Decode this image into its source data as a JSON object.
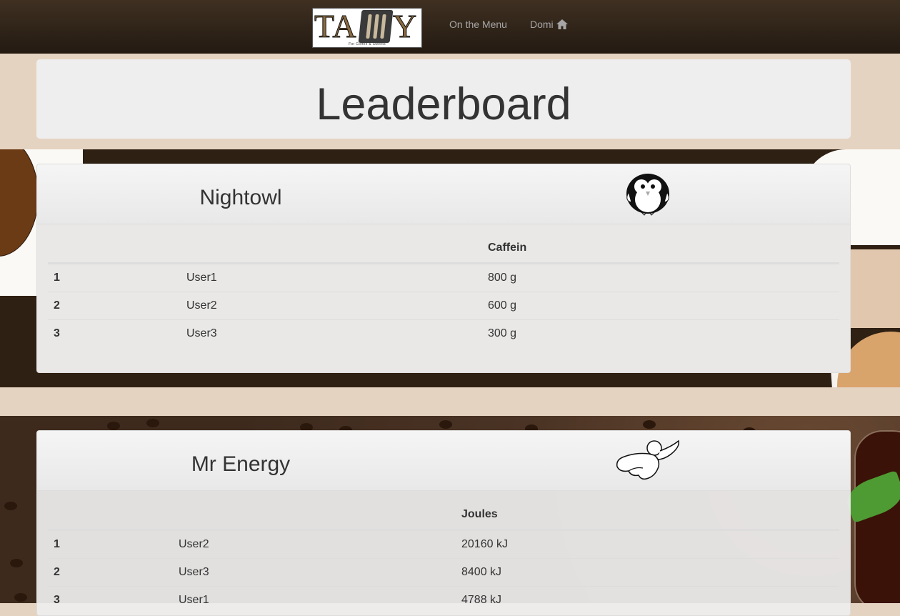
{
  "navbar": {
    "logo_letters_left": "TA",
    "logo_letters_right": "Y",
    "logo_caption": "For Coffee & Sweets",
    "menu_link": "On the Menu",
    "user_link": "Domi",
    "user_icon": "home-icon"
  },
  "page": {
    "title": "Leaderboard"
  },
  "boards": [
    {
      "title": "Nightowl",
      "icon": "owl-icon",
      "metric_header": "Caffein",
      "rows": [
        {
          "rank": "1",
          "user": "User1",
          "value": "800 g"
        },
        {
          "rank": "2",
          "user": "User2",
          "value": "600 g"
        },
        {
          "rank": "3",
          "user": "User3",
          "value": "300 g"
        }
      ]
    },
    {
      "title": "Mr Energy",
      "icon": "superhero-icon",
      "metric_header": "Joules",
      "rows": [
        {
          "rank": "1",
          "user": "User2",
          "value": "20160 kJ"
        },
        {
          "rank": "2",
          "user": "User3",
          "value": "8400 kJ"
        },
        {
          "rank": "3",
          "user": "User1",
          "value": "4788 kJ"
        }
      ]
    }
  ]
}
